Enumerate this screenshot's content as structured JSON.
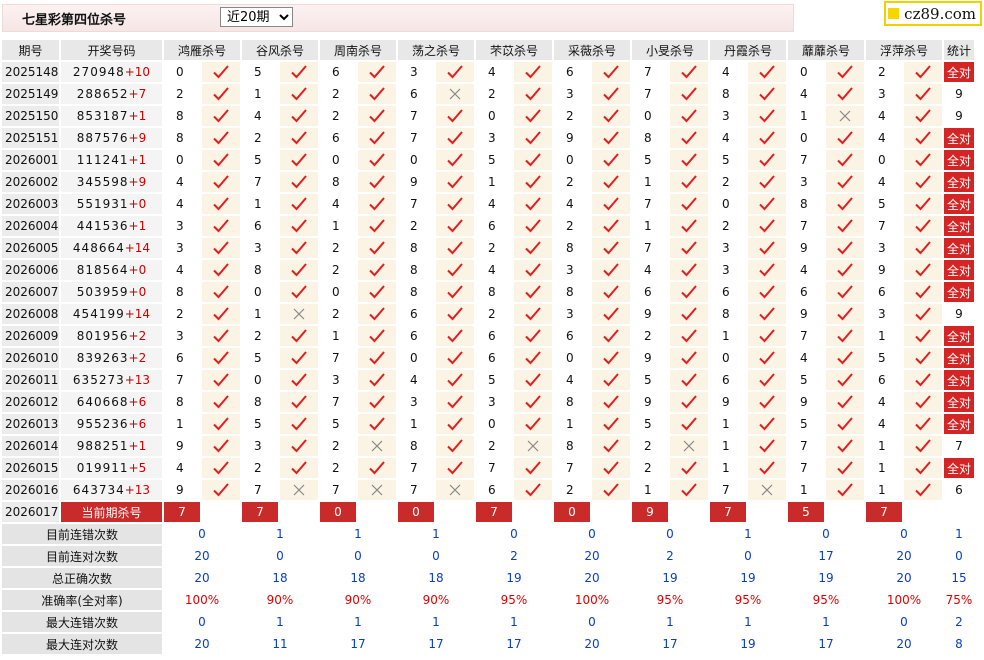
{
  "header": {
    "title": "七星彩第四位杀号",
    "period_selected": "近20期",
    "period_options": [
      "近20期"
    ],
    "logo_text": "cz89.com"
  },
  "columns": {
    "issue": "期号",
    "draw": "开奖号码",
    "experts": [
      "鸿雁杀号",
      "谷风杀号",
      "周南杀号",
      "荡之杀号",
      "芣苡杀号",
      "采薇杀号",
      "小旻杀号",
      "丹霞杀号",
      "蘼蘼杀号",
      "浮萍杀号"
    ],
    "stats": "统计"
  },
  "colors": {
    "hit": "#e21e1e",
    "miss": "#888888",
    "all_right_bg": "#d42424",
    "stat_value": "#0a3fbd",
    "stat_rate": "#e00000"
  },
  "rows": [
    {
      "issue": "2025148",
      "draw": "270948",
      "sum": "+10",
      "kills": [
        0,
        5,
        6,
        3,
        4,
        6,
        7,
        4,
        0,
        2
      ],
      "hits": [
        1,
        1,
        1,
        1,
        1,
        1,
        1,
        1,
        1,
        1
      ],
      "stat": "全对"
    },
    {
      "issue": "2025149",
      "draw": "288652",
      "sum": "+7",
      "kills": [
        2,
        1,
        2,
        6,
        2,
        3,
        7,
        8,
        4,
        3
      ],
      "hits": [
        1,
        1,
        1,
        0,
        1,
        1,
        1,
        1,
        1,
        1
      ],
      "stat": "9"
    },
    {
      "issue": "2025150",
      "draw": "853187",
      "sum": "+1",
      "kills": [
        8,
        4,
        2,
        7,
        0,
        2,
        0,
        3,
        1,
        4
      ],
      "hits": [
        1,
        1,
        1,
        1,
        1,
        1,
        1,
        1,
        0,
        1
      ],
      "stat": "9"
    },
    {
      "issue": "2025151",
      "draw": "887576",
      "sum": "+9",
      "kills": [
        8,
        2,
        6,
        7,
        3,
        9,
        8,
        4,
        0,
        4
      ],
      "hits": [
        1,
        1,
        1,
        1,
        1,
        1,
        1,
        1,
        1,
        1
      ],
      "stat": "全对"
    },
    {
      "issue": "2026001",
      "draw": "111241",
      "sum": "+1",
      "kills": [
        0,
        5,
        0,
        0,
        5,
        0,
        5,
        5,
        7,
        0
      ],
      "hits": [
        1,
        1,
        1,
        1,
        1,
        1,
        1,
        1,
        1,
        1
      ],
      "stat": "全对"
    },
    {
      "issue": "2026002",
      "draw": "345598",
      "sum": "+9",
      "kills": [
        4,
        7,
        8,
        9,
        1,
        2,
        1,
        2,
        3,
        4
      ],
      "hits": [
        1,
        1,
        1,
        1,
        1,
        1,
        1,
        1,
        1,
        1
      ],
      "stat": "全对"
    },
    {
      "issue": "2026003",
      "draw": "551931",
      "sum": "+0",
      "kills": [
        4,
        1,
        4,
        7,
        4,
        4,
        7,
        0,
        8,
        5
      ],
      "hits": [
        1,
        1,
        1,
        1,
        1,
        1,
        1,
        1,
        1,
        1
      ],
      "stat": "全对"
    },
    {
      "issue": "2026004",
      "draw": "441536",
      "sum": "+1",
      "kills": [
        3,
        6,
        1,
        2,
        6,
        2,
        1,
        2,
        7,
        7
      ],
      "hits": [
        1,
        1,
        1,
        1,
        1,
        1,
        1,
        1,
        1,
        1
      ],
      "stat": "全对"
    },
    {
      "issue": "2026005",
      "draw": "448664",
      "sum": "+14",
      "kills": [
        3,
        3,
        2,
        8,
        2,
        8,
        7,
        3,
        9,
        3
      ],
      "hits": [
        1,
        1,
        1,
        1,
        1,
        1,
        1,
        1,
        1,
        1
      ],
      "stat": "全对"
    },
    {
      "issue": "2026006",
      "draw": "818564",
      "sum": "+0",
      "kills": [
        4,
        8,
        2,
        8,
        4,
        3,
        4,
        3,
        4,
        9
      ],
      "hits": [
        1,
        1,
        1,
        1,
        1,
        1,
        1,
        1,
        1,
        1
      ],
      "stat": "全对"
    },
    {
      "issue": "2026007",
      "draw": "503959",
      "sum": "+0",
      "kills": [
        8,
        0,
        0,
        8,
        8,
        8,
        6,
        6,
        6,
        6
      ],
      "hits": [
        1,
        1,
        1,
        1,
        1,
        1,
        1,
        1,
        1,
        1
      ],
      "stat": "全对"
    },
    {
      "issue": "2026008",
      "draw": "454199",
      "sum": "+14",
      "kills": [
        2,
        1,
        2,
        6,
        2,
        3,
        9,
        8,
        9,
        3
      ],
      "hits": [
        1,
        0,
        1,
        1,
        1,
        1,
        1,
        1,
        1,
        1
      ],
      "stat": "9"
    },
    {
      "issue": "2026009",
      "draw": "801956",
      "sum": "+2",
      "kills": [
        3,
        2,
        1,
        6,
        6,
        6,
        2,
        1,
        7,
        1
      ],
      "hits": [
        1,
        1,
        1,
        1,
        1,
        1,
        1,
        1,
        1,
        1
      ],
      "stat": "全对"
    },
    {
      "issue": "2026010",
      "draw": "839263",
      "sum": "+2",
      "kills": [
        6,
        5,
        7,
        0,
        6,
        0,
        9,
        0,
        4,
        5
      ],
      "hits": [
        1,
        1,
        1,
        1,
        1,
        1,
        1,
        1,
        1,
        1
      ],
      "stat": "全对"
    },
    {
      "issue": "2026011",
      "draw": "635273",
      "sum": "+13",
      "kills": [
        7,
        0,
        3,
        4,
        5,
        4,
        5,
        6,
        5,
        6
      ],
      "hits": [
        1,
        1,
        1,
        1,
        1,
        1,
        1,
        1,
        1,
        1
      ],
      "stat": "全对"
    },
    {
      "issue": "2026012",
      "draw": "640668",
      "sum": "+6",
      "kills": [
        8,
        8,
        7,
        3,
        3,
        8,
        9,
        9,
        9,
        4
      ],
      "hits": [
        1,
        1,
        1,
        1,
        1,
        1,
        1,
        1,
        1,
        1
      ],
      "stat": "全对"
    },
    {
      "issue": "2026013",
      "draw": "955236",
      "sum": "+6",
      "kills": [
        1,
        5,
        5,
        1,
        0,
        1,
        5,
        1,
        5,
        4
      ],
      "hits": [
        1,
        1,
        1,
        1,
        1,
        1,
        1,
        1,
        1,
        1
      ],
      "stat": "全对"
    },
    {
      "issue": "2026014",
      "draw": "988251",
      "sum": "+1",
      "kills": [
        9,
        3,
        2,
        8,
        2,
        8,
        2,
        1,
        7,
        1
      ],
      "hits": [
        1,
        1,
        0,
        1,
        0,
        1,
        0,
        1,
        1,
        1
      ],
      "stat": "7"
    },
    {
      "issue": "2026015",
      "draw": "019911",
      "sum": "+5",
      "kills": [
        4,
        2,
        2,
        7,
        7,
        7,
        2,
        1,
        7,
        1
      ],
      "hits": [
        1,
        1,
        1,
        1,
        1,
        1,
        1,
        1,
        1,
        1
      ],
      "stat": "全对"
    },
    {
      "issue": "2026016",
      "draw": "643734",
      "sum": "+13",
      "kills": [
        9,
        7,
        7,
        7,
        6,
        2,
        1,
        7,
        1,
        1
      ],
      "hits": [
        1,
        0,
        0,
        0,
        1,
        1,
        1,
        0,
        1,
        1
      ],
      "stat": "6"
    }
  ],
  "current": {
    "issue": "2026017",
    "label": "当前期杀号",
    "kills": [
      "7",
      "7",
      "0",
      "0",
      "7",
      "0",
      "9",
      "7",
      "5",
      "7"
    ]
  },
  "stats_rows": [
    {
      "label": "目前连错次数",
      "values": [
        "0",
        "1",
        "1",
        "1",
        "0",
        "0",
        "0",
        "1",
        "0",
        "0",
        "1"
      ],
      "red": false
    },
    {
      "label": "目前连对次数",
      "values": [
        "20",
        "0",
        "0",
        "0",
        "2",
        "20",
        "2",
        "0",
        "17",
        "20",
        "0"
      ],
      "red": false
    },
    {
      "label": "总正确次数",
      "values": [
        "20",
        "18",
        "18",
        "18",
        "19",
        "20",
        "19",
        "19",
        "19",
        "20",
        "15"
      ],
      "red": false
    },
    {
      "label": "准确率(全对率)",
      "values": [
        "100%",
        "90%",
        "90%",
        "90%",
        "95%",
        "100%",
        "95%",
        "95%",
        "95%",
        "100%",
        "75%"
      ],
      "red": true
    },
    {
      "label": "最大连错次数",
      "values": [
        "0",
        "1",
        "1",
        "1",
        "1",
        "0",
        "1",
        "1",
        "1",
        "0",
        "2"
      ],
      "red": false
    },
    {
      "label": "最大连对次数",
      "values": [
        "20",
        "11",
        "17",
        "17",
        "17",
        "20",
        "17",
        "19",
        "17",
        "20",
        "8"
      ],
      "red": false
    }
  ]
}
